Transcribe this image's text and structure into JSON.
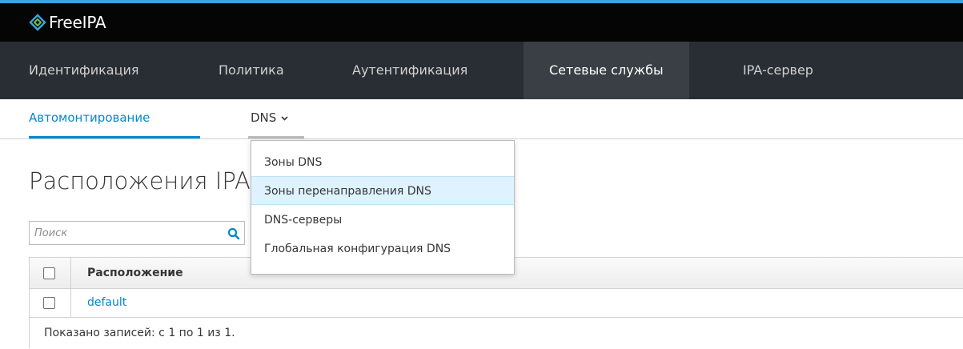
{
  "brand": {
    "name": "FreeIPA",
    "logo_icon": "freeipa-logo-icon",
    "accent": "#39a5dc"
  },
  "nav": {
    "items": [
      {
        "label": "Идентификация"
      },
      {
        "label": "Политика"
      },
      {
        "label": "Аутентификация"
      },
      {
        "label": "Сетевые службы",
        "active": true
      },
      {
        "label": "IPA-сервер"
      }
    ]
  },
  "subnav": {
    "automount": "Автомонтирование",
    "dns": "DNS",
    "dns_icon": "chevron-down-icon"
  },
  "dns_menu": {
    "items": [
      {
        "label": "Зоны DNS"
      },
      {
        "label": "Зоны перенаправления DNS",
        "highlighted": true
      },
      {
        "label": "DNS-серверы"
      },
      {
        "label": "Глобальная конфигурация DNS"
      }
    ]
  },
  "page": {
    "title": "Расположения IPA",
    "search_placeholder": "Поиск",
    "search_icon": "search-icon"
  },
  "table": {
    "column": "Расположение",
    "rows": [
      {
        "name": "default"
      }
    ],
    "footer": "Показано записей: с 1 по 1 из 1."
  },
  "colors": {
    "link": "#0088ce",
    "nav_bg": "#292e34",
    "nav_active": "#393f44",
    "brand_bg": "#050505"
  }
}
